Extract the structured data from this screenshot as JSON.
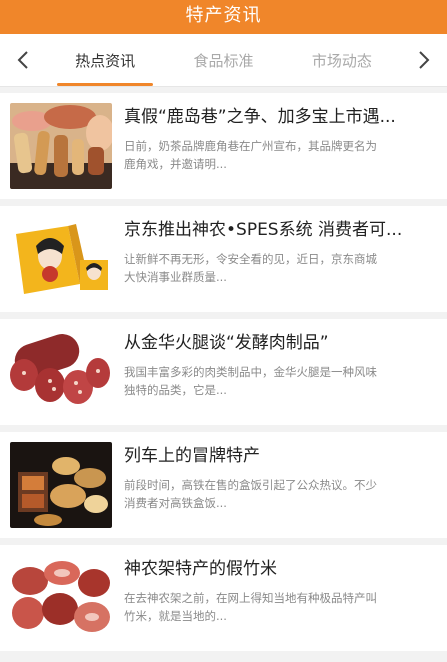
{
  "header": {
    "title": "特产资讯"
  },
  "nav": {
    "prev_icon": "chevron-left-icon",
    "next_icon": "chevron-right-icon",
    "tabs": [
      {
        "label": "热点资讯",
        "active": true
      },
      {
        "label": "食品标准",
        "active": false
      },
      {
        "label": "市场动态",
        "active": false
      }
    ]
  },
  "colors": {
    "accent": "#f0862a",
    "background": "#f2f2f2"
  },
  "articles": [
    {
      "title": "真假“鹿岛巷”之争、加多宝上市遇...",
      "desc": "日前，奶茶品牌鹿角巷在广州宣布，其品牌更名为\n鹿角戏，并邀请明..."
    },
    {
      "title": "京东推出神农•SPES系统 消费者可...",
      "desc": "让新鲜不再无形，令安全看的见，近日，京东商城\n大快消事业群质量..."
    },
    {
      "title": "从金华火腿谈“发酵肉制品”",
      "desc": "我国丰富多彩的肉类制品中，金华火腿是一种风味\n独特的品类，它是..."
    },
    {
      "title": "列车上的冒牌特产",
      "desc": "前段时间，高铁在售的盒饭引起了公众热议。不少\n消费者对高铁盒饭..."
    },
    {
      "title": "神农架特产的假竹米",
      "desc": "在去神农架之前，在网上得知当地有种极品特产叫\n竹米，就是当地的..."
    }
  ]
}
